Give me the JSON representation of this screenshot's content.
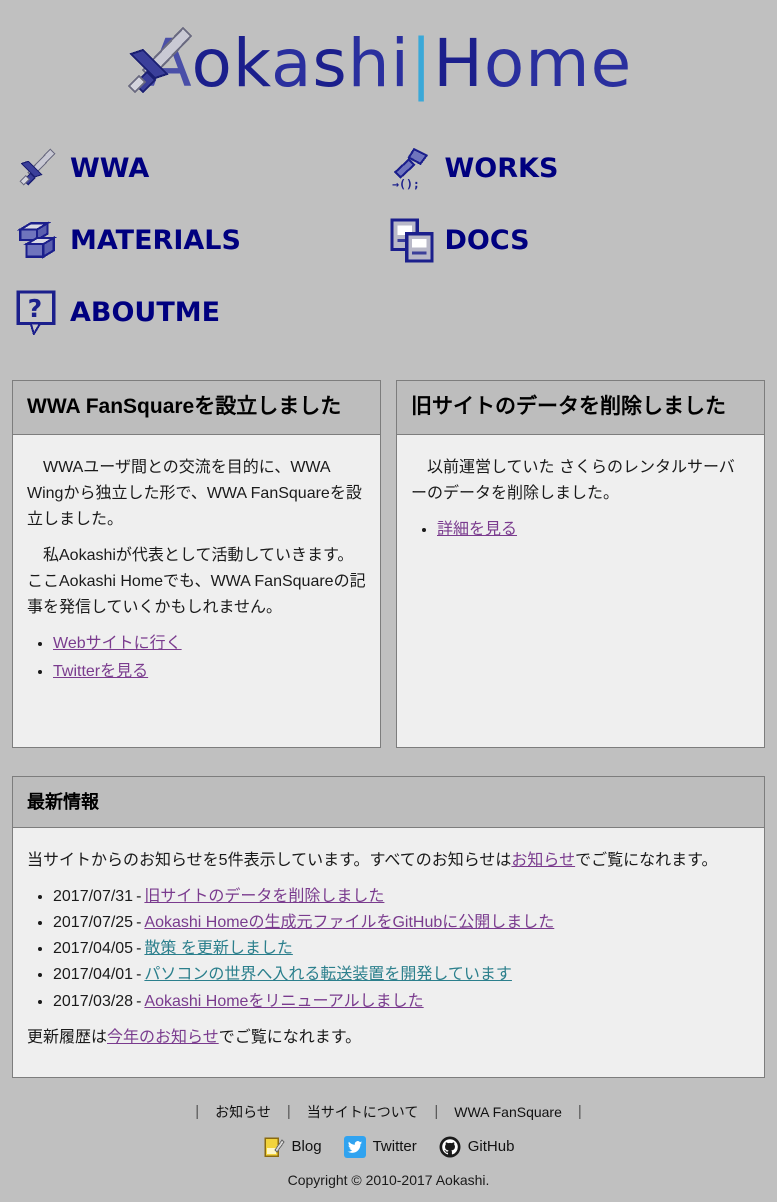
{
  "site": {
    "logo_text": "AokashiHome",
    "logo_icon": "sword-icon"
  },
  "nav": {
    "items": [
      {
        "label": "WWA",
        "icon": "sword-icon"
      },
      {
        "label": "WORKS",
        "icon": "hammer-code-icon"
      },
      {
        "label": "MATERIALS",
        "icon": "boxes-icon"
      },
      {
        "label": "DOCS",
        "icon": "documents-icon"
      },
      {
        "label": "ABOUTME",
        "icon": "question-balloon-icon"
      }
    ]
  },
  "panels": [
    {
      "title": "WWA FanSquareを設立しました",
      "paragraphs": [
        "WWAユーザ間との交流を目的に、WWA Wingから独立した形で、WWA FanSquareを設立しました。",
        "私Aokashiが代表として活動していきます。ここAokashi Homeでも、WWA FanSquareの記事を発信していくかもしれません。"
      ],
      "links": [
        {
          "label": "Webサイトに行く",
          "state": "visited"
        },
        {
          "label": "Twitterを見る",
          "state": "visited"
        }
      ]
    },
    {
      "title": "旧サイトのデータを削除しました",
      "paragraphs": [
        "以前運営していた さくらのレンタルサーバーのデータを削除しました。"
      ],
      "links": [
        {
          "label": "詳細を見る",
          "state": "visited"
        }
      ]
    }
  ],
  "news": {
    "title": "最新情報",
    "intro_before": "当サイトからのお知らせを5件表示しています。すべてのお知らせは",
    "intro_link": "お知らせ",
    "intro_after": "でご覧になれます。",
    "items": [
      {
        "date": "2017/07/31",
        "label": "旧サイトのデータを削除しました",
        "state": "visited"
      },
      {
        "date": "2017/07/25",
        "label": "Aokashi Homeの生成元ファイルをGitHubに公開しました",
        "state": "visited"
      },
      {
        "date": "2017/04/05",
        "label": "散策 を更新しました",
        "state": "unvisited"
      },
      {
        "date": "2017/04/01",
        "label": "パソコンの世界へ入れる転送装置を開発しています",
        "state": "unvisited"
      },
      {
        "date": "2017/03/28",
        "label": "Aokashi Homeをリニューアルしました",
        "state": "visited"
      }
    ],
    "outro_before": "更新履歴は",
    "outro_link": "今年のお知らせ",
    "outro_after": "でご覧になれます。"
  },
  "footer": {
    "nav": [
      "お知らせ",
      "当サイトについて",
      "WWA FanSquare"
    ],
    "social": [
      {
        "label": "Blog",
        "icon": "notepad-pencil-icon"
      },
      {
        "label": "Twitter",
        "icon": "twitter-bird-icon"
      },
      {
        "label": "GitHub",
        "icon": "github-octocat-icon"
      }
    ],
    "copyright": "Copyright © 2010-2017 Aokashi."
  },
  "colors": {
    "page_bg": "#c0c0c0",
    "panel_bg": "#efefef",
    "panel_head_bg": "#bdbdbd",
    "border": "#7d7d7d",
    "nav_label": "#00007f",
    "link_visited": "#7a3b8e",
    "link_unvisited": "#2b7f8c",
    "logo_blue": "#2a2f9e",
    "logo_cyan": "#3aa8d8",
    "twitter_blue": "#30a3f0"
  }
}
